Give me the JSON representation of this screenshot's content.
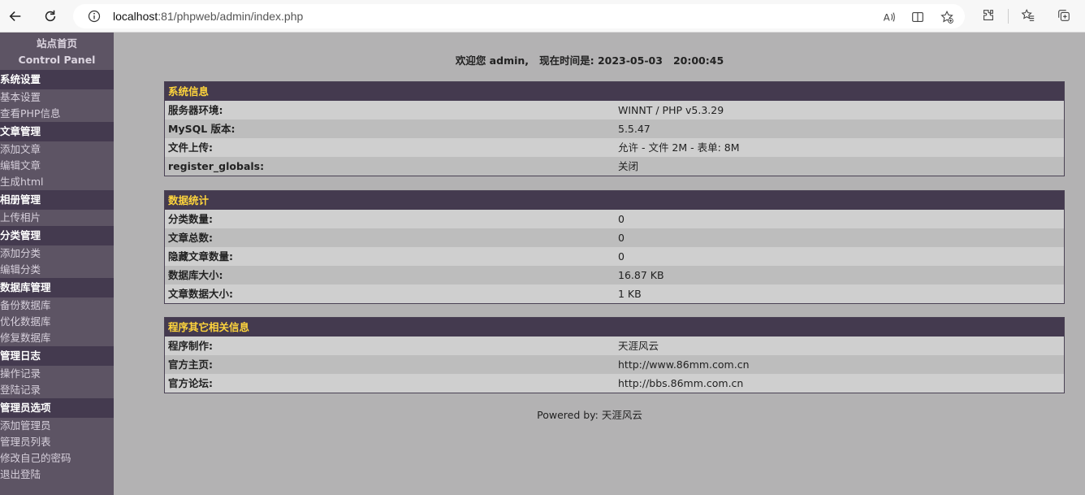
{
  "browser": {
    "url_host": "localhost",
    "url_rest": ":81/phpweb/admin/index.php"
  },
  "sidebar": {
    "home_label": "站点首页",
    "panel_label": "Control Panel",
    "sections": [
      {
        "title": "系统设置",
        "items": [
          "基本设置",
          "查看PHP信息"
        ]
      },
      {
        "title": "文章管理",
        "items": [
          "添加文章",
          "编辑文章",
          "生成html"
        ]
      },
      {
        "title": "相册管理",
        "items": [
          "上传相片"
        ]
      },
      {
        "title": "分类管理",
        "items": [
          "添加分类",
          "编辑分类"
        ]
      },
      {
        "title": "数据库管理",
        "items": [
          "备份数据库",
          "优化数据库",
          "修复数据库"
        ]
      },
      {
        "title": "管理日志",
        "items": [
          "操作记录",
          "登陆记录"
        ]
      },
      {
        "title": "管理员选项",
        "items": [
          "添加管理员",
          "管理员列表",
          "修改自己的密码",
          "退出登陆"
        ]
      }
    ]
  },
  "welcome": {
    "greeting": "欢迎您 admin,",
    "time_label": "现在时间是: 2023-05-03",
    "time_value": "20:00:45"
  },
  "panels": [
    {
      "title": "系统信息",
      "rows": [
        {
          "k": "服务器环境:",
          "v": "WINNT / PHP v5.3.29"
        },
        {
          "k": "MySQL 版本:",
          "v": "5.5.47"
        },
        {
          "k": "文件上传:",
          "v": "允许 - 文件 2M - 表单: 8M"
        },
        {
          "k": "register_globals:",
          "v": "关闭"
        }
      ]
    },
    {
      "title": "数据统计",
      "rows": [
        {
          "k": "分类数量:",
          "v": "0"
        },
        {
          "k": "文章总数:",
          "v": "0"
        },
        {
          "k": "隐藏文章数量:",
          "v": "0"
        },
        {
          "k": "数据库大小:",
          "v": "16.87 KB"
        },
        {
          "k": "文章数据大小:",
          "v": "1 KB"
        }
      ]
    },
    {
      "title": "程序其它相关信息",
      "rows": [
        {
          "k": "程序制作:",
          "v": "天涯风云"
        },
        {
          "k": "官方主页:",
          "v": "http://www.86mm.com.cn"
        },
        {
          "k": "官方论坛:",
          "v": "http://bbs.86mm.com.cn"
        }
      ]
    }
  ],
  "footer": {
    "text": "Powered by: 天涯风云"
  }
}
